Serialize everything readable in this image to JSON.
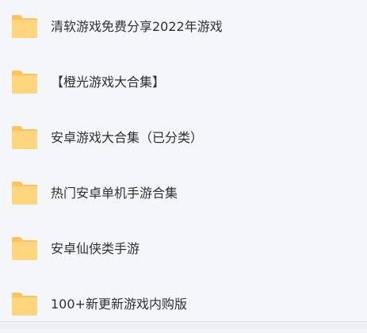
{
  "colors": {
    "background": "#f5f6fa",
    "folder_back": "#ffc35a",
    "folder_front": "#ffd57e",
    "text": "#2f3033"
  },
  "files": [
    {
      "icon": "folder-icon",
      "name": "清软游戏免费分享2022年游戏"
    },
    {
      "icon": "folder-icon",
      "name": "【橙光游戏大合集】"
    },
    {
      "icon": "folder-icon",
      "name": "安卓游戏大合集（已分类）"
    },
    {
      "icon": "folder-icon",
      "name": "热门安卓单机手游合集"
    },
    {
      "icon": "folder-icon",
      "name": "安卓仙侠类手游"
    },
    {
      "icon": "folder-icon",
      "name": "100+新更新游戏内购版"
    }
  ]
}
